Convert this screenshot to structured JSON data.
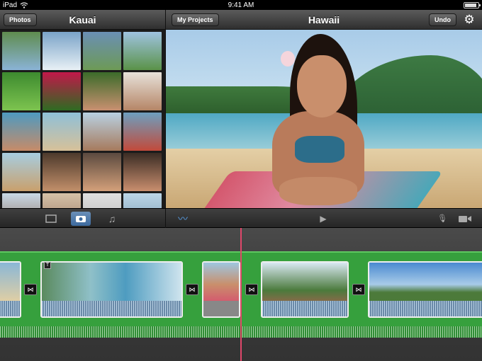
{
  "status": {
    "device": "iPad",
    "time": "9:41 AM"
  },
  "left_toolbar": {
    "photos_button": "Photos",
    "title": "Kauai"
  },
  "right_toolbar": {
    "projects_button": "My Projects",
    "title": "Hawaii",
    "undo_button": "Undo"
  },
  "icons": {
    "wifi": "wifi-icon",
    "battery": "battery-icon",
    "gear": "gear-icon",
    "video_mode": "video-icon",
    "photo_mode": "camera-icon",
    "audio_mode": "music-icon",
    "waveform": "waveform-icon",
    "play": "play-icon",
    "mic": "microphone-icon",
    "camera": "video-camera-icon"
  },
  "glyphs": {
    "gear": "⚙",
    "play": "▶",
    "music": "♫",
    "mic": "🎙",
    "waveform": "〰",
    "transition": "⋈",
    "title_badge": "T"
  },
  "colors": {
    "accent": "#3d6a9e",
    "track_green": "#36a03d",
    "playhead": "#e0476a"
  },
  "photo_thumbnails": [
    [
      "#5f8c4f",
      "#8ab3d6"
    ],
    [
      "#7aa3c8",
      "#e8f0f5"
    ],
    [
      "#6a8fb4",
      "#6d9a56"
    ],
    [
      "#9fc3e0",
      "#5a9248"
    ],
    [
      "#3d8a2f",
      "#7dc44f"
    ],
    [
      "#c2184a",
      "#2e6b22"
    ],
    [
      "#3b6b2a",
      "#c99070"
    ],
    [
      "#e7e2da",
      "#b58566"
    ],
    [
      "#4e9ac0",
      "#c78b68"
    ],
    [
      "#8fc0d8",
      "#d7c199"
    ],
    [
      "#b9d1e2",
      "#a67a5c"
    ],
    [
      "#6d9fbf",
      "#c24a3a"
    ],
    [
      "#a7cde0",
      "#c9a06c"
    ],
    [
      "#4d3a2c",
      "#c28f6a"
    ],
    [
      "#5b4a3f",
      "#d4a07a"
    ],
    [
      "#3a2c24",
      "#c98e6e"
    ],
    [
      "#c9d9e6",
      "#8a7060"
    ],
    [
      "#d6c2a8",
      "#9a7a64"
    ],
    [
      "#e0e0e0",
      "#b4b4b4"
    ],
    [
      "#bcd6e8",
      "#7a9ab0"
    ]
  ]
}
